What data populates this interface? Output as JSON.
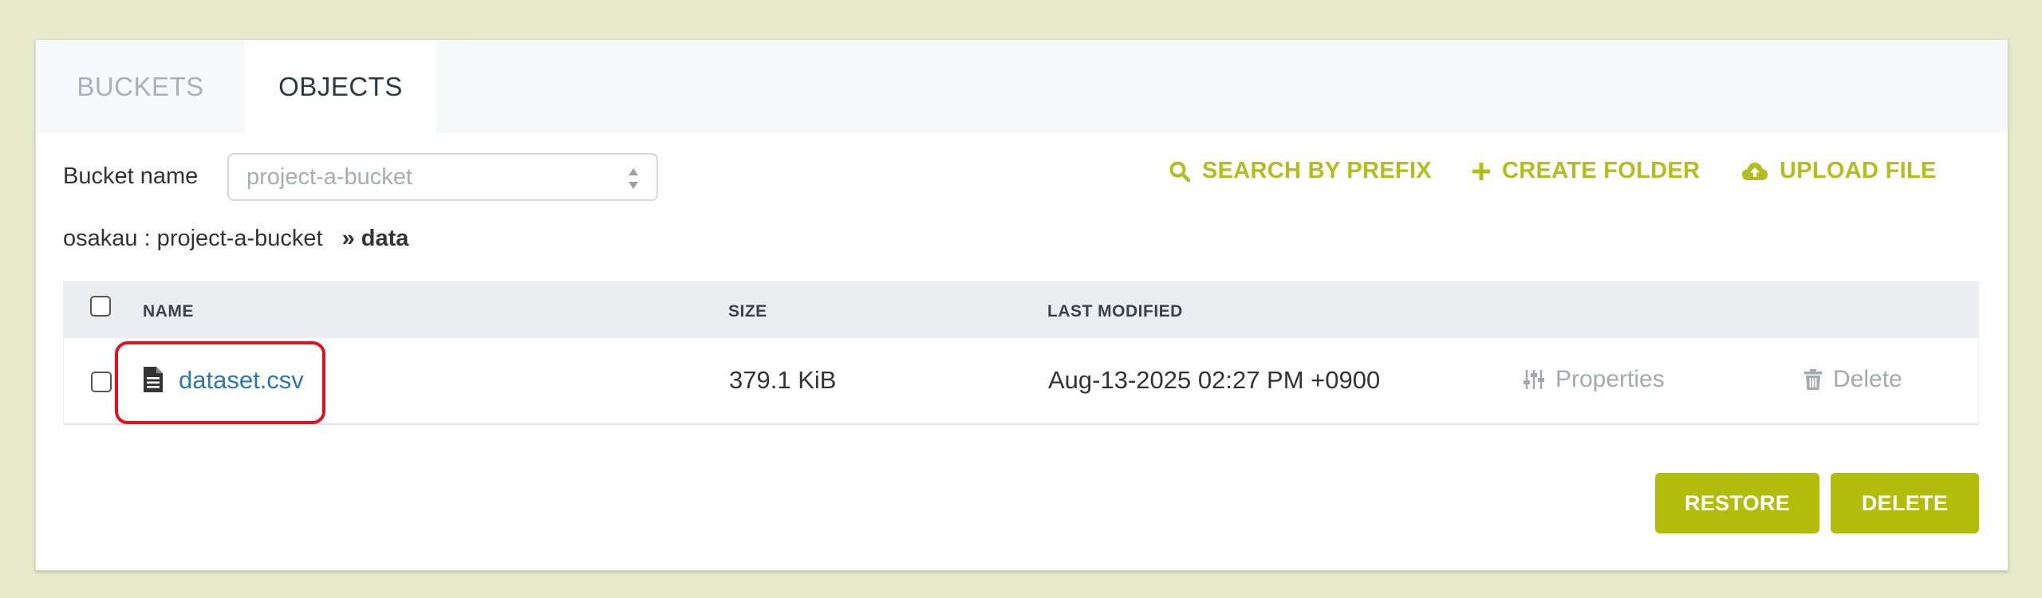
{
  "tabs": [
    {
      "label": "BUCKETS",
      "active": false
    },
    {
      "label": "OBJECTS",
      "active": true
    }
  ],
  "bucket": {
    "label": "Bucket name",
    "placeholder": "project-a-bucket"
  },
  "actions": {
    "search": "SEARCH BY PREFIX",
    "create_folder": "CREATE FOLDER",
    "upload": "UPLOAD FILE"
  },
  "breadcrumb": {
    "root": "osakau : project-a-bucket",
    "separator": "»",
    "current": "data"
  },
  "table": {
    "columns": [
      "NAME",
      "SIZE",
      "LAST MODIFIED"
    ],
    "rows": [
      {
        "name": "dataset.csv",
        "size": "379.1 KiB",
        "modified": "Aug-13-2025 02:27 PM +0900",
        "properties": "Properties",
        "delete": "Delete"
      }
    ]
  },
  "buttons": {
    "restore": "RESTORE",
    "delete": "DELETE"
  },
  "colors": {
    "accent": "#b2bc0a",
    "link": "#2a78b6",
    "highlight": "#e5101e",
    "background": "#e8ebcb"
  },
  "icons": {
    "search": "search-icon",
    "create_folder": "plus-icon",
    "upload": "cloud-upload-icon",
    "file": "document-icon",
    "properties": "sliders-icon",
    "delete": "trash-icon",
    "select_arrows": "up-down-arrows-icon"
  }
}
